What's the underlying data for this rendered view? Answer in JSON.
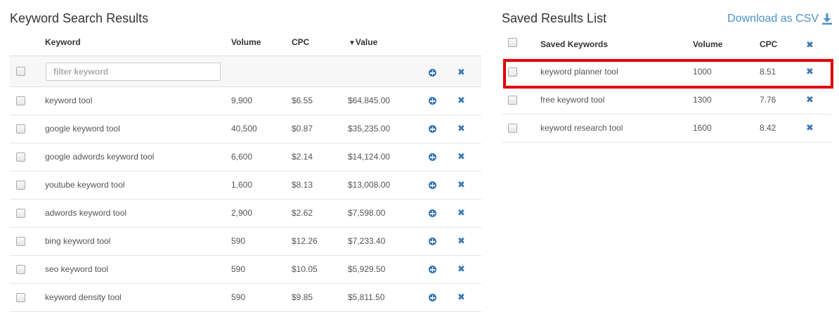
{
  "left_panel": {
    "title": "Keyword Search Results",
    "columns": {
      "keyword": "Keyword",
      "volume": "Volume",
      "cpc": "CPC",
      "value": "Value",
      "sort_indicator": "▼"
    },
    "filter_placeholder": "filter keyword",
    "rows": [
      {
        "keyword": "keyword tool",
        "volume": "9,900",
        "cpc": "$6.55",
        "value": "$64,845.00"
      },
      {
        "keyword": "google keyword tool",
        "volume": "40,500",
        "cpc": "$0.87",
        "value": "$35,235.00"
      },
      {
        "keyword": "google adwords keyword tool",
        "volume": "6,600",
        "cpc": "$2.14",
        "value": "$14,124.00"
      },
      {
        "keyword": "youtube keyword tool",
        "volume": "1,600",
        "cpc": "$8.13",
        "value": "$13,008.00"
      },
      {
        "keyword": "adwords keyword tool",
        "volume": "2,900",
        "cpc": "$2.62",
        "value": "$7,598.00"
      },
      {
        "keyword": "bing keyword tool",
        "volume": "590",
        "cpc": "$12.26",
        "value": "$7,233.40"
      },
      {
        "keyword": "seo keyword tool",
        "volume": "590",
        "cpc": "$10.05",
        "value": "$5,929.50"
      },
      {
        "keyword": "keyword density tool",
        "volume": "590",
        "cpc": "$9.85",
        "value": "$5,811.50"
      }
    ]
  },
  "right_panel": {
    "title": "Saved Results List",
    "download_label": "Download as CSV",
    "columns": {
      "keyword": "Saved Keywords",
      "volume": "Volume",
      "cpc": "CPC"
    },
    "rows": [
      {
        "keyword": "keyword planner tool",
        "volume": "1000",
        "cpc": "8.51"
      },
      {
        "keyword": "free keyword tool",
        "volume": "1300",
        "cpc": "7.76"
      },
      {
        "keyword": "keyword research tool",
        "volume": "1600",
        "cpc": "8.42"
      }
    ]
  },
  "icons": {
    "add": "plus-circle-icon",
    "remove": "close-icon",
    "download": "download-icon"
  },
  "colors": {
    "accent": "#3a78b5",
    "link": "#4a90c9",
    "highlight": "#e00000"
  }
}
